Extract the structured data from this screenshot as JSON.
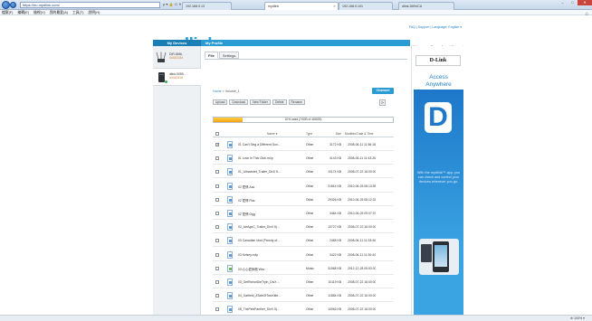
{
  "browser": {
    "address": "https://eu.mydlink.com/",
    "address_controls": "ρ ▾ 🔒 ☐ ✕",
    "tabs": [
      "192.168.0.13",
      "mydlink",
      "192.168.0.101",
      "dlink-D694CA"
    ],
    "window_controls": [
      "–",
      "□",
      "✕"
    ],
    "menu": [
      "檔案(F)",
      "編輯(E)",
      "檢視(V)",
      "我的最愛(A)",
      "工具(T)",
      "說明(H)"
    ],
    "zoom": "⊕ 100% ▾"
  },
  "header": {
    "top_links": "FAQ | Support | Language: English ▾",
    "logo_my": "my",
    "logo_dlink": "dlink",
    "welcome_prefix": "Welcome,",
    "welcome_user": "edison chou",
    "sign_out": "Sign out"
  },
  "nav": {
    "my_devices": "My Devices",
    "my_profile": "My Profile"
  },
  "devices": [
    {
      "name": "DIR-868L",
      "id": "44443184",
      "online": false
    },
    {
      "name": "dlink-0059...",
      "id": "44442416",
      "online": true
    }
  ],
  "file_tabs": [
    "File",
    "Settings"
  ],
  "breadcrumb": {
    "home": "Home",
    "sep": " > ",
    "current": "Volume_1"
  },
  "channel_label": "Channel",
  "actions": [
    "Upload",
    "Download",
    "New Folder",
    "Delete",
    "Rename"
  ],
  "refresh_icon": "refresh-icon",
  "usage": {
    "text": "10% used (74GB of 465GB)",
    "fraction": 0.16
  },
  "table": {
    "headers": {
      "name": "Name ▾",
      "type": "Type",
      "size": "Size",
      "date": "Modified Date & Time"
    },
    "rows": [
      {
        "name": "01 Can't Sing a Different Son...",
        "type": "Other",
        "size": "3172 KB",
        "date": "2008-06-11 11:56:18",
        "checked": true,
        "icon": "file-icon"
      },
      {
        "name": "01 Love In This Club.m4p",
        "type": "Other",
        "size": "4143 KB",
        "date": "2008-06-11 11:43:26",
        "checked": false,
        "icon": "file-icon"
      },
      {
        "name": "01_Ultraviolet_Trailer_DivX 5...",
        "type": "Other",
        "size": "10174 KB",
        "date": "2008-07-22 16:00:00",
        "checked": false,
        "icon": "file-icon"
      },
      {
        "name": "02 愛情 Aac",
        "type": "Other",
        "size": "21814 KB",
        "date": "2010-06-25 08:13:55",
        "checked": false,
        "icon": "file-icon"
      },
      {
        "name": "02 愛情 Flac",
        "type": "Other",
        "size": "29326 KB",
        "date": "2010-06-25 08:12:31",
        "checked": false,
        "icon": "file-icon"
      },
      {
        "name": "02 愛情 Ogg",
        "type": "Other",
        "size": "3464 KB",
        "date": "2010-06-25 09:07:07",
        "checked": false,
        "icon": "file-icon"
      },
      {
        "name": "02_IceAgeC_Trailer_DivX 5)...",
        "type": "Other",
        "size": "10727 KB",
        "date": "2008-07-22 16:00:00",
        "checked": false,
        "icon": "file-icon"
      },
      {
        "name": "03 Canadian Idiot (Parody of...",
        "type": "Other",
        "size": "2468 KB",
        "date": "2008-06-11 11:33:46",
        "checked": false,
        "icon": "file-icon"
      },
      {
        "name": "03 Kelsey.m4p",
        "type": "Other",
        "size": "3422 KB",
        "date": "2008-06-11 11:30:44",
        "checked": false,
        "icon": "file-icon"
      },
      {
        "name": "03 心心愛我唱 Wav",
        "type": "Music",
        "size": "31568 KB",
        "date": "2012-12-28 05:53:30",
        "checked": false,
        "icon": "music-file-icon"
      },
      {
        "name": "03_GetRichorDieTryin_DivX ...",
        "type": "Other",
        "size": "10119 KB",
        "date": "2008-07-22 16:00:00",
        "checked": false,
        "icon": "file-icon"
      },
      {
        "name": "04_Garfield_ATaleOfTwoKitte...",
        "type": "Other",
        "size": "11884 KB",
        "date": "2008-07-22 16:00:00",
        "checked": false,
        "icon": "file-icon"
      },
      {
        "name": "05_ThePinkPanther_DivX 5)...",
        "type": "Other",
        "size": "10063 KB",
        "date": "2008-07-22 16:00:00",
        "checked": false,
        "icon": "file-icon"
      }
    ]
  },
  "ad": {
    "brand": "D-Link",
    "headline_1": "Access",
    "headline_2": "Anywhere",
    "letter": "D",
    "body": "With the mydlink™ app, you can check and control your devices wherever you go."
  }
}
